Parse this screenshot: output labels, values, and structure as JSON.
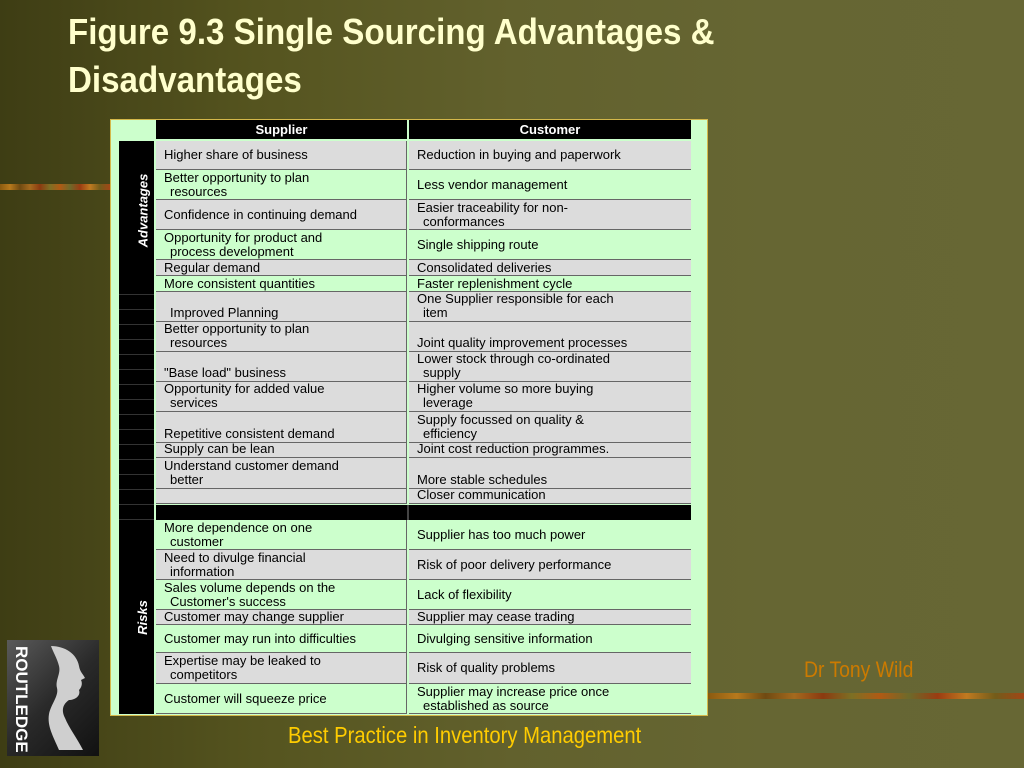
{
  "title": "Figure 9.3 Single Sourcing Advantages & Disadvantages",
  "table": {
    "headers": {
      "supplier": "Supplier",
      "customer": "Customer"
    },
    "side_labels": {
      "advantages": "Advantages",
      "risks": "Risks"
    },
    "advantage_rows": [
      {
        "supplier": "Higher share of business",
        "customer": "Reduction in buying and paperwork"
      },
      {
        "supplier": "Better opportunity to plan resources",
        "customer": "Less vendor management"
      },
      {
        "supplier": "Confidence in continuing demand",
        "customer": "Easier traceability for non-conformances"
      },
      {
        "supplier": "Opportunity for product and process development",
        "customer": "Single shipping route"
      },
      {
        "supplier": "Regular demand",
        "customer": "Consolidated deliveries"
      },
      {
        "supplier": "More consistent quantities",
        "customer": "Faster replenishment cycle"
      }
    ],
    "additional_rows": [
      {
        "supplier": "Improved Planning",
        "customer": "One Supplier responsible for each item"
      },
      {
        "supplier": "Better opportunity to plan resources",
        "customer": "Joint quality improvement processes"
      },
      {
        "supplier": "\"Base load\" business",
        "customer": "Lower stock through co-ordinated supply"
      },
      {
        "supplier": "Opportunity for added value services",
        "customer": "Higher volume so more buying leverage"
      },
      {
        "supplier": "Repetitive consistent demand",
        "customer": "Supply focussed on quality & efficiency"
      },
      {
        "supplier": "Supply can be lean",
        "customer": "Joint cost reduction programmes."
      },
      {
        "supplier": "Understand customer demand better",
        "customer": "More stable schedules"
      },
      {
        "supplier": "",
        "customer": "Closer communication"
      }
    ],
    "risk_rows": [
      {
        "supplier": "More dependence on one customer",
        "customer": "Supplier has too much power"
      },
      {
        "supplier": "Need to divulge financial information",
        "customer": "Risk of poor delivery performance"
      },
      {
        "supplier": "Sales volume depends on the Customer's success",
        "customer": "Lack of flexibility"
      },
      {
        "supplier": "Customer may change supplier",
        "customer": "Supplier may cease trading"
      },
      {
        "supplier": "Customer may run into difficulties",
        "customer": "Divulging sensitive information"
      },
      {
        "supplier": "Expertise may be leaked to competitors",
        "customer": "Risk of quality problems"
      },
      {
        "supplier": "Customer will squeeze price",
        "customer": "Supplier may increase price once established as source"
      }
    ]
  },
  "logo": {
    "text": "ROUTLEDGE",
    "icon": "profile-silhouette-icon"
  },
  "author": "Dr Tony Wild",
  "footer": "Best Practice in Inventory Management",
  "colors": {
    "title": "#ffffcc",
    "table_green": "#ccffcc",
    "table_gray": "#dcdcdc",
    "author": "#cc7a00",
    "footer": "#ffcc00"
  }
}
